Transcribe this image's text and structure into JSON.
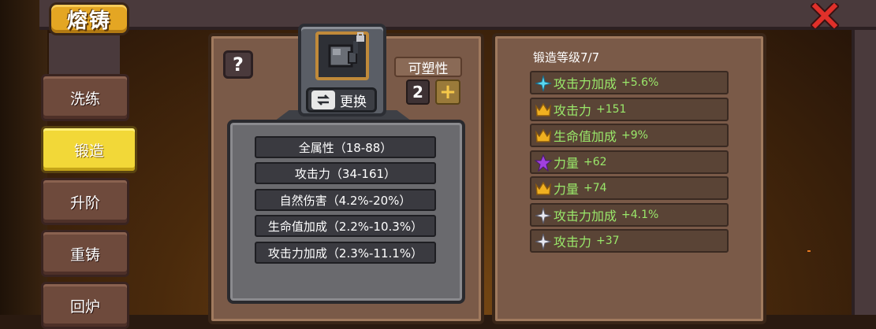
{
  "header": {
    "title": "熔铸"
  },
  "tabs": [
    {
      "label": "洗练",
      "active": false
    },
    {
      "label": "锻造",
      "active": true
    },
    {
      "label": "升阶",
      "active": false
    },
    {
      "label": "重铸",
      "active": false
    },
    {
      "label": "回炉",
      "active": false
    }
  ],
  "left_panel": {
    "help_label": "?",
    "swap_label": "更换",
    "plasticity_label": "可塑性",
    "plasticity_value": "2",
    "plus_label": "+",
    "ranges": [
      "全属性（18-88）",
      "攻击力（34-161）",
      "自然伤害（4.2%-20%）",
      "生命值加成（2.2%-10.3%）",
      "攻击力加成（2.3%-11.1%）"
    ]
  },
  "right_panel": {
    "forge_level": "锻造等级7/7",
    "stats": [
      {
        "icon": "cyan-star-icon",
        "label": "攻击力加成",
        "value": "+5.6%",
        "color": "#5ad8f0"
      },
      {
        "icon": "gold-crown-icon",
        "label": "攻击力",
        "value": "+151",
        "color": "#f0b020"
      },
      {
        "icon": "gold-crown-icon",
        "label": "生命值加成",
        "value": "+9%",
        "color": "#f0b020"
      },
      {
        "icon": "purple-star-icon",
        "label": "力量",
        "value": "+62",
        "color": "#a040e0"
      },
      {
        "icon": "gold-crown-icon",
        "label": "力量",
        "value": "+74",
        "color": "#f0b020"
      },
      {
        "icon": "white-star-icon",
        "label": "攻击力加成",
        "value": "+4.1%",
        "color": "#e8e8f0"
      },
      {
        "icon": "white-star-icon",
        "label": "攻击力",
        "value": "+37",
        "color": "#e8e8f0"
      }
    ]
  },
  "colors": {
    "stat_text": "#9ae86a",
    "active_tab": "#f2d838",
    "title_plate": "#e4a623"
  }
}
